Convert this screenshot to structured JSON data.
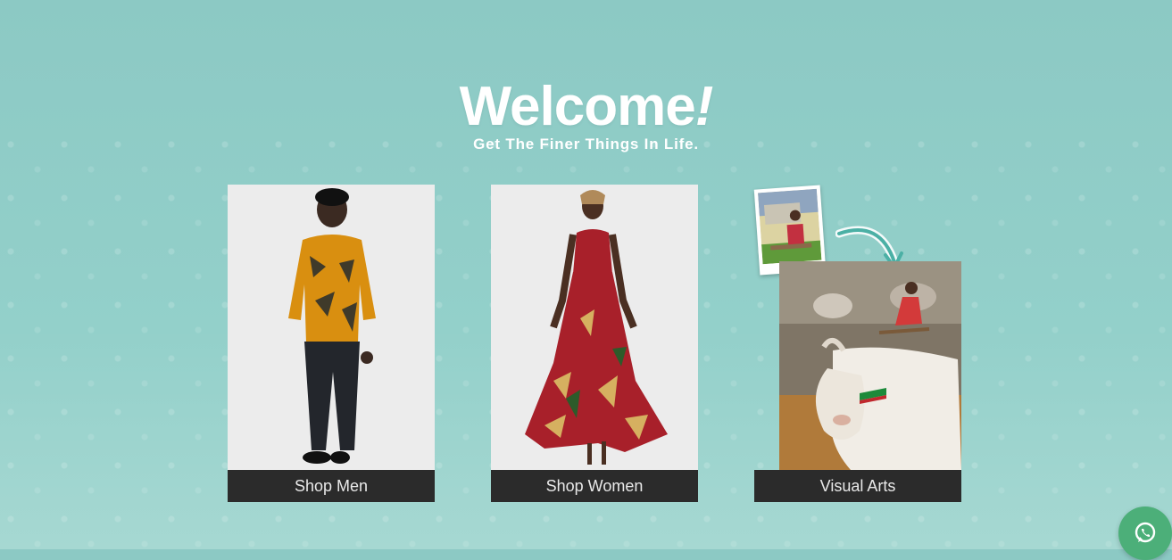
{
  "hero": {
    "title": "Welcome",
    "title_mark": "!",
    "subtitle": "Get The Finer Things In Life."
  },
  "cards": [
    {
      "label": "Shop Men"
    },
    {
      "label": "Shop Women"
    },
    {
      "label": "Visual Arts"
    }
  ],
  "colors": {
    "background": "#8cc9c4",
    "cta_bg": "#2b2b2b",
    "cta_text": "#e9e9e9",
    "whatsapp": "#4caf79"
  },
  "icons": {
    "chat": "whatsapp-icon",
    "arrow": "curved-arrow-icon"
  }
}
